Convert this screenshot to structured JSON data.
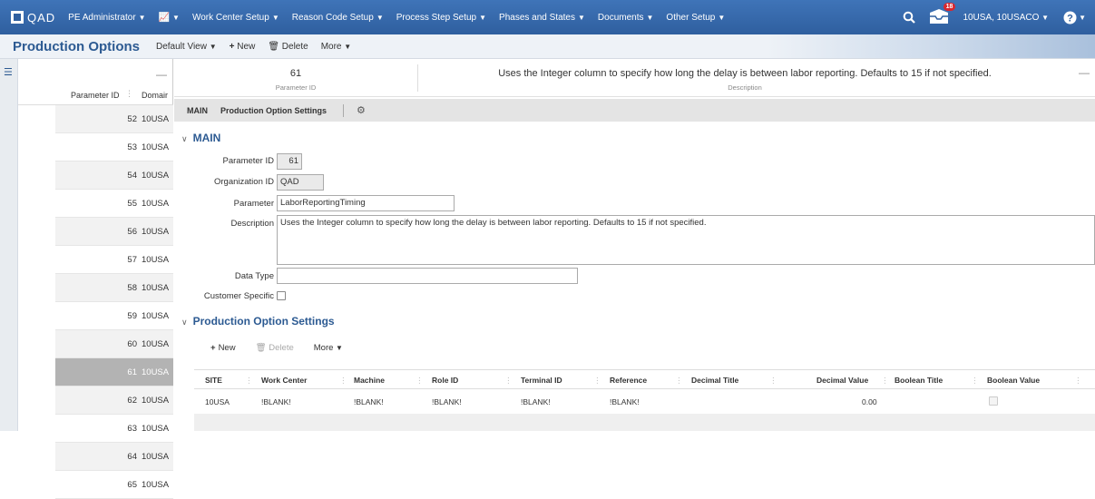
{
  "topnav": {
    "brand": "QAD",
    "role": "PE Administrator",
    "menus": [
      "Work Center Setup",
      "Reason Code Setup",
      "Process Step Setup",
      "Phases and States",
      "Documents",
      "Other Setup"
    ],
    "notifications_count": "18",
    "domain": "10USA, 10USACO"
  },
  "toolbar": {
    "page_title": "Production Options",
    "view": "Default View",
    "new_label": "New",
    "delete_label": "Delete",
    "more_label": "More"
  },
  "list": {
    "col_parameter_id": "Parameter ID",
    "col_domain": "Domair",
    "rows": [
      {
        "id": "52",
        "domain": "10USA"
      },
      {
        "id": "53",
        "domain": "10USA"
      },
      {
        "id": "54",
        "domain": "10USA"
      },
      {
        "id": "55",
        "domain": "10USA"
      },
      {
        "id": "56",
        "domain": "10USA"
      },
      {
        "id": "57",
        "domain": "10USA"
      },
      {
        "id": "58",
        "domain": "10USA"
      },
      {
        "id": "59",
        "domain": "10USA"
      },
      {
        "id": "60",
        "domain": "10USA"
      },
      {
        "id": "61",
        "domain": "10USA"
      },
      {
        "id": "62",
        "domain": "10USA"
      },
      {
        "id": "63",
        "domain": "10USA"
      },
      {
        "id": "64",
        "domain": "10USA"
      },
      {
        "id": "65",
        "domain": "10USA"
      }
    ],
    "selected_id": "61"
  },
  "summary": {
    "parameter_id_value": "61",
    "parameter_id_label": "Parameter ID",
    "description_value": "Uses the Integer column to specify how long the delay is between labor reporting. Defaults to 15 if not specified.",
    "description_label": "Description"
  },
  "tabs": {
    "main": "MAIN",
    "settings": "Production Option Settings"
  },
  "form": {
    "section_title": "MAIN",
    "parameter_id_label": "Parameter ID",
    "parameter_id": "61",
    "organization_id_label": "Organization ID",
    "organization_id": "QAD",
    "parameter_label": "Parameter",
    "parameter": "LaborReportingTiming",
    "description_label": "Description",
    "description": "Uses the Integer column to specify how long the delay is between labor reporting. Defaults to 15 if not specified.",
    "data_type_label": "Data Type",
    "data_type": "",
    "customer_specific_label": "Customer Specific",
    "customer_specific": false
  },
  "settings": {
    "section_title": "Production Option Settings",
    "new_label": "New",
    "delete_label": "Delete",
    "more_label": "More",
    "columns": [
      "SITE",
      "Work Center",
      "Machine",
      "Role ID",
      "Terminal ID",
      "Reference",
      "Decimal Title",
      "Decimal Value",
      "Boolean Title",
      "Boolean Value"
    ],
    "rows": [
      {
        "site": "10USA",
        "work_center": "!BLANK!",
        "machine": "!BLANK!",
        "role_id": "!BLANK!",
        "terminal_id": "!BLANK!",
        "reference": "!BLANK!",
        "decimal_title": "",
        "decimal_value": "0.00",
        "boolean_title": "",
        "boolean_value": false
      }
    ]
  }
}
